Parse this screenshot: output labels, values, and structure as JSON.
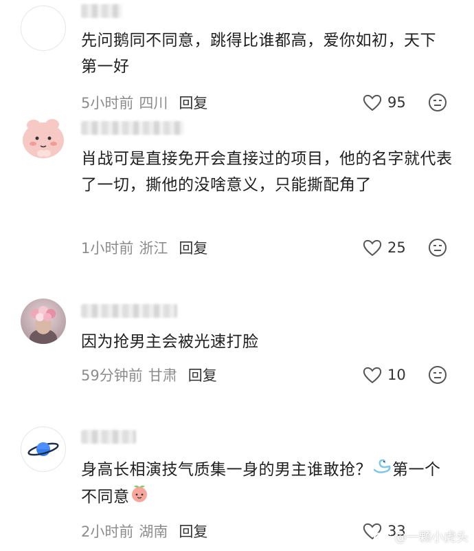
{
  "comments": [
    {
      "text": "先问鹅同不同意，跳得比谁都高，爱你如初，天下第一好",
      "time": "5小时前",
      "location": "四川",
      "reply_label": "回复",
      "likes": "95",
      "avatar_icon": "blank-avatar-icon"
    },
    {
      "text": "肖战可是直接免开会直接过的项目，他的名字就代表了一切，撕他的没啥意义，只能撕配角了",
      "time": "1小时前",
      "location": "浙江",
      "reply_label": "回复",
      "likes": "25",
      "avatar_icon": "pink-character-avatar-icon"
    },
    {
      "text": "因为抢男主会被光速打脸",
      "time": "59分钟前",
      "location": "甘肃",
      "reply_label": "回复",
      "likes": "10",
      "avatar_icon": "photo-avatar-icon"
    },
    {
      "text_before_emoji": "身高长相演技气质集一身的男主谁敢抢？",
      "text_after_emoji": "第一个不同意",
      "time": "2小时前",
      "location": "湖南",
      "reply_label": "回复",
      "likes": "33",
      "avatar_icon": "planet-avatar-icon",
      "emojis": [
        "swan-emoji-icon",
        "peach-emoji-icon"
      ]
    }
  ],
  "watermark": {
    "text": "@一颗小虎头",
    "icon": "weibo-logo-icon"
  },
  "colors": {
    "meta_text": "#8c8c8c",
    "body_text": "#1f1f1f",
    "icon_stroke": "#555555"
  }
}
